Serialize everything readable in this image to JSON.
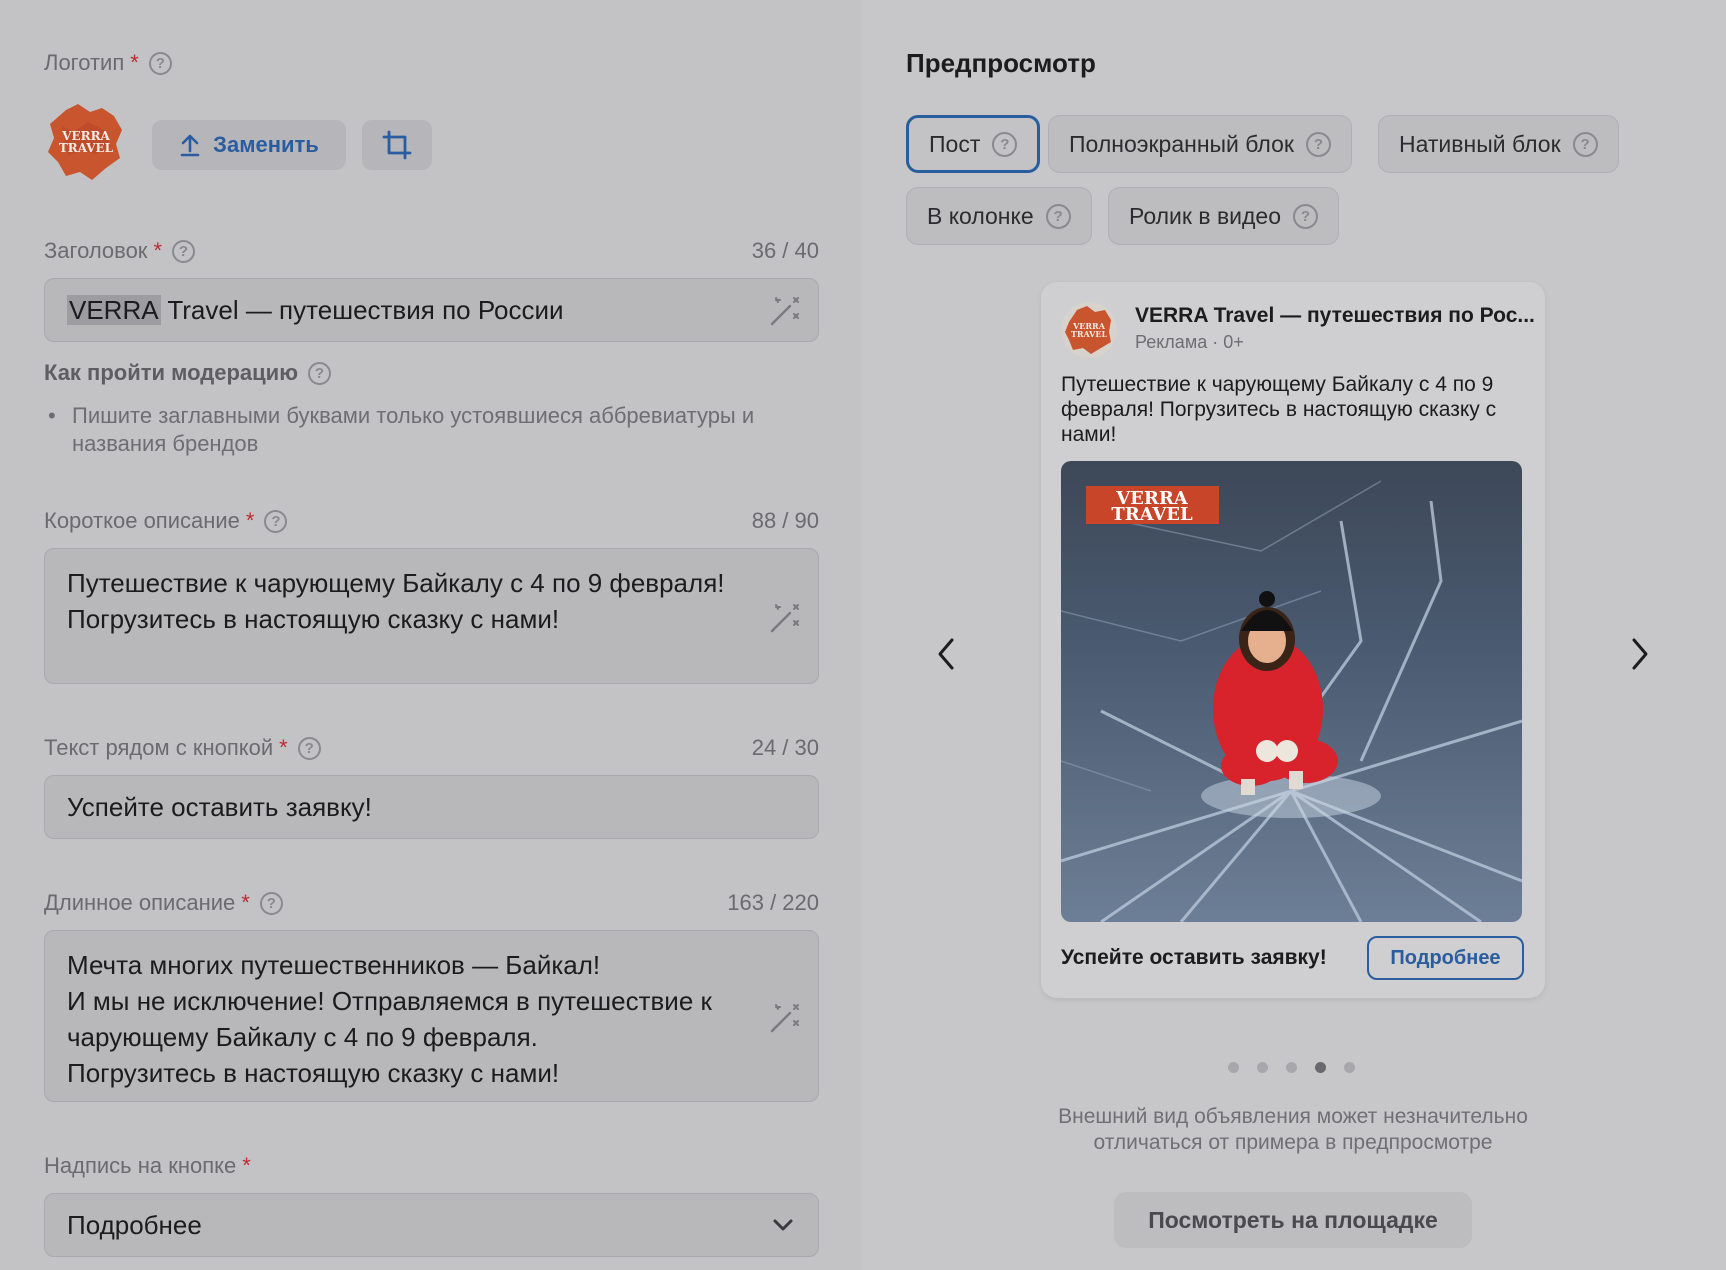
{
  "logo": {
    "label": "Логотип",
    "logo_text_top": "VERRA",
    "logo_text_bottom": "TRAVEL",
    "replace_label": "Заменить"
  },
  "headline": {
    "label": "Заголовок",
    "counter": "36 / 40",
    "value_highlight": "VERRA",
    "value_rest": " Travel — путешествия по России"
  },
  "moderation": {
    "title": "Как пройти модерацию",
    "tip": "Пишите заглавными буквами только устоявшиеся аббревиатуры и названия брендов"
  },
  "short_description": {
    "label": "Короткое описание",
    "counter": "88 / 90",
    "value": "Путешествие к чарующему Байкалу с 4 по 9 февраля!\nПогрузитесь в настоящую сказку с нами!"
  },
  "button_text": {
    "label": "Текст рядом с кнопкой",
    "counter": "24 / 30",
    "value": "Успейте оставить заявку!"
  },
  "long_description": {
    "label": "Длинное описание",
    "counter": "163 / 220",
    "value": "Мечта многих путешественников — Байкал!\nИ мы не исключение! Отправляемся в путешествие к чарующему Байкалу с 4 по 9 февраля.\nПогрузитесь в настоящую сказку с нами!"
  },
  "button_caption": {
    "label": "Надпись на кнопке",
    "selected": "Подробнее"
  },
  "preview": {
    "title": "Предпросмотр",
    "tabs": [
      {
        "label": "Пост",
        "active": true
      },
      {
        "label": "Полноэкранный блок",
        "active": false
      },
      {
        "label": "Нативный блок",
        "active": false
      },
      {
        "label": "В колонке",
        "active": false
      },
      {
        "label": "Ролик в видео",
        "active": false
      }
    ],
    "card": {
      "title": "VERRA Travel — путешествия по Рос...",
      "subtitle": "Реклама · 0+",
      "text": "Путешествие к чарующему Байкалу с 4 по 9 февраля! Погрузитесь в настоящую сказку с нами!",
      "photo_badge_top": "VERRA",
      "photo_badge_bottom": "TRAVEL",
      "cta_text": "Успейте оставить заявку!",
      "cta_button": "Подробнее"
    },
    "dots_count": 5,
    "active_dot": 4,
    "note": "Внешний вид объявления может незначительно отличаться от примера в предпросмотре",
    "view_button": "Посмотреть на площадке"
  },
  "required_mark": "*",
  "help_mark": "?",
  "colors": {
    "accent": "#2a5d9f",
    "required": "#c02a35",
    "brand_orange": "#d0532a"
  },
  "icons": [
    "help-icon",
    "upload-icon",
    "crop-icon",
    "magic-wand-icon",
    "chevron-down-icon",
    "chevron-left-icon",
    "chevron-right-icon"
  ]
}
